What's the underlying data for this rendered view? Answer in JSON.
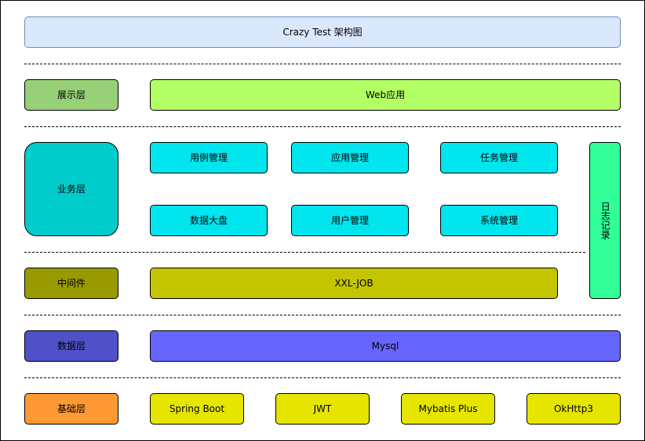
{
  "title": "Crazy Test 架构图",
  "colors": {
    "title_fill": "#dae8fc",
    "title_border": "#6c8ebf",
    "presentation_layer": "#97d077",
    "presentation_item": "#b3ff66",
    "business_layer": "#00cccc",
    "business_item": "#00e5ee",
    "middleware_layer": "#999900",
    "middleware_item": "#c4c400",
    "data_layer": "#5050c8",
    "data_item": "#6666ff",
    "foundation_layer": "#ff9933",
    "foundation_item": "#e5e500",
    "log": "#33ff99"
  },
  "layers": {
    "presentation": {
      "label": "展示层",
      "items": [
        "Web应用"
      ]
    },
    "business": {
      "label": "业务层",
      "items": [
        "用例管理",
        "应用管理",
        "任务管理",
        "数据大盘",
        "用户管理",
        "系统管理"
      ]
    },
    "middleware": {
      "label": "中间件",
      "items": [
        "XXL-JOB"
      ]
    },
    "data": {
      "label": "数据层",
      "items": [
        "Mysql"
      ]
    },
    "foundation": {
      "label": "基础层",
      "items": [
        "Spring Boot",
        "JWT",
        "Mybatis Plus",
        "OkHttp3"
      ]
    }
  },
  "log": {
    "label": "日志记录"
  }
}
